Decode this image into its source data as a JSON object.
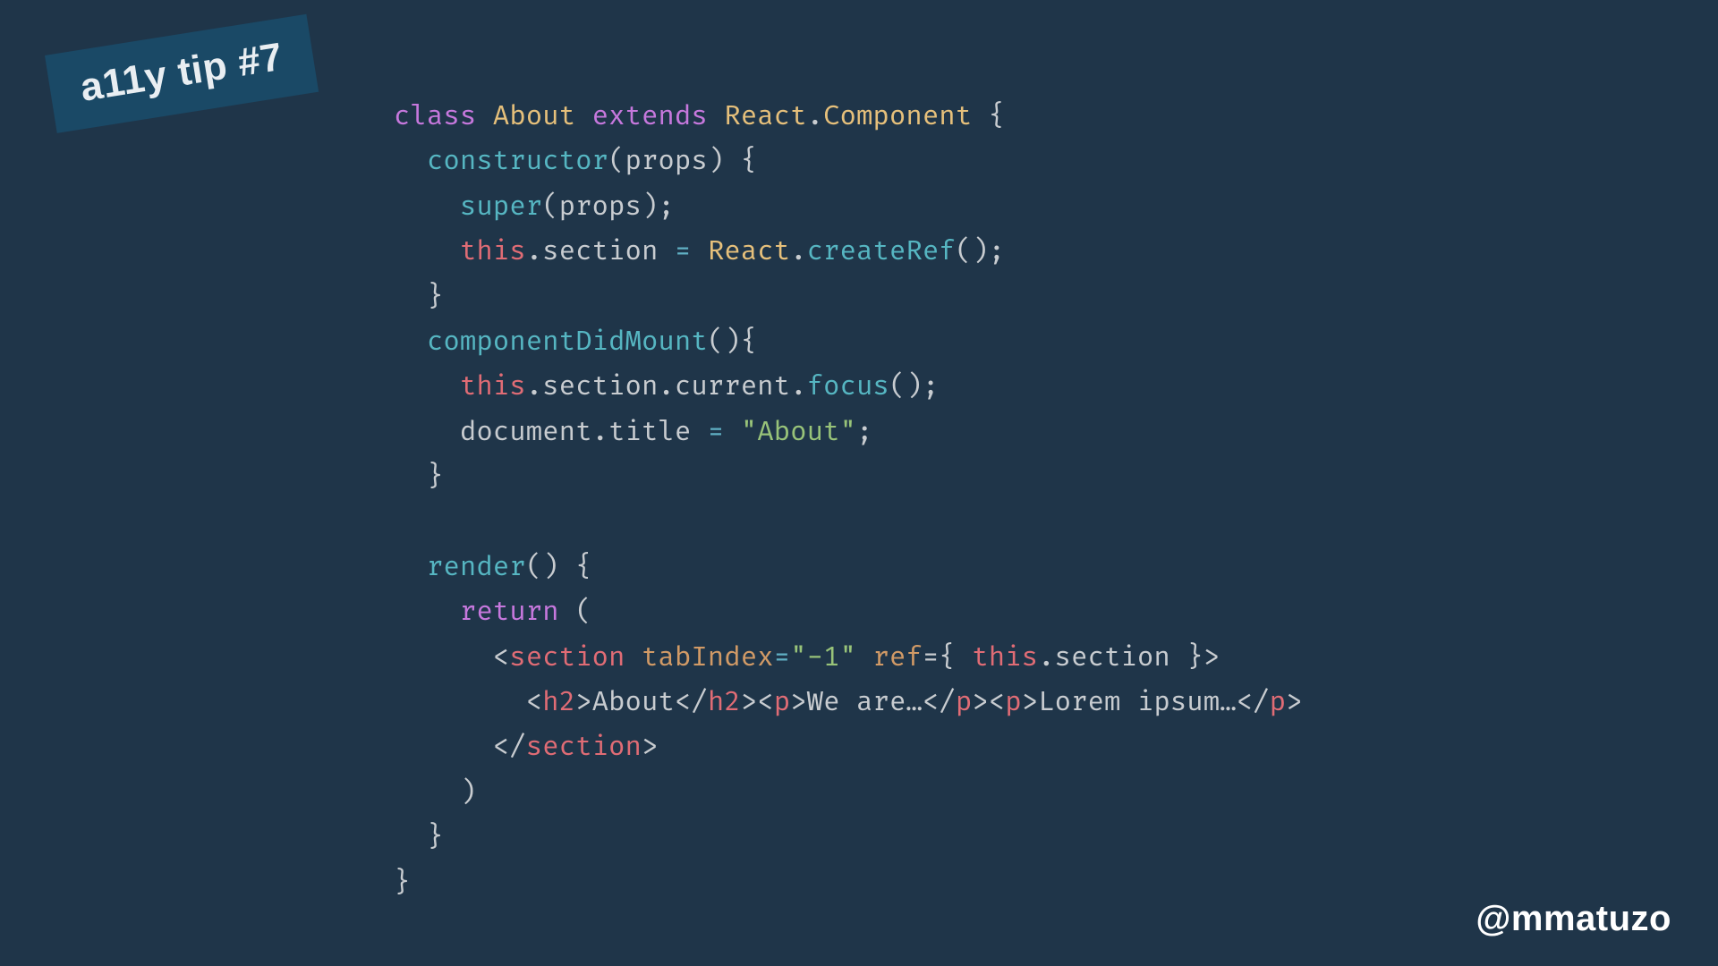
{
  "badge": {
    "label": "a11y tip #7"
  },
  "footer": {
    "handle": "@mmatuzo"
  },
  "code": {
    "l1": {
      "kw1": "class",
      "cls": "About",
      "kw2": "extends",
      "react": "React",
      "dot": ".",
      "comp": "Component",
      "open": " {"
    },
    "l2": {
      "indent": "  ",
      "fn": "constructor",
      "rest": "(props) {"
    },
    "l3": {
      "indent": "    ",
      "sup": "super",
      "rest": "(props);"
    },
    "l4": {
      "indent": "    ",
      "this": "this",
      "rest1": ".section ",
      "eq": "= ",
      "react": "React",
      "dot": ".",
      "fn": "createRef",
      "rest2": "();"
    },
    "l5": {
      "indent": "  ",
      "brace": "}"
    },
    "l6": {
      "indent": "  ",
      "fn": "componentDidMount",
      "rest": "(){"
    },
    "l7": {
      "indent": "    ",
      "this": "this",
      "rest1": ".section.current.",
      "fn": "focus",
      "rest2": "();"
    },
    "l8": {
      "indent": "    ",
      "rest1": "document.title ",
      "eq": "= ",
      "str": "\"About\"",
      "semi": ";"
    },
    "l9": {
      "indent": "  ",
      "brace": "}"
    },
    "blank": "",
    "l11": {
      "indent": "  ",
      "fn": "render",
      "rest": "() {"
    },
    "l12": {
      "indent": "    ",
      "kw": "return",
      "rest": " ("
    },
    "l13": {
      "indent": "      ",
      "lt": "<",
      "tag": "section",
      "sp": " ",
      "attr1": "tabIndex",
      "eq1": "=",
      "val1": "\"-1\"",
      "sp2": " ",
      "attr2": "ref",
      "eq2": "={ ",
      "this": "this",
      "rest": ".section }",
      "gt": ">"
    },
    "l14": {
      "indent": "        ",
      "lt1": "<",
      "tag1": "h2",
      "gt1": ">",
      "txt1": "About",
      "lt2": "</",
      "tag2": "h2",
      "gt2": ">",
      "lt3": "<",
      "tag3": "p",
      "gt3": ">",
      "txt2": "We are…",
      "lt4": "</",
      "tag4": "p",
      "gt4": ">",
      "lt5": "<",
      "tag5": "p",
      "gt5": ">",
      "txt3": "Lorem ipsum…",
      "lt6": "</",
      "tag6": "p",
      "gt6": ">"
    },
    "l15": {
      "indent": "      ",
      "lt": "</",
      "tag": "section",
      "gt": ">"
    },
    "l16": {
      "indent": "    ",
      "paren": ")"
    },
    "l17": {
      "indent": "  ",
      "brace": "}"
    },
    "l18": {
      "brace": "}"
    }
  }
}
